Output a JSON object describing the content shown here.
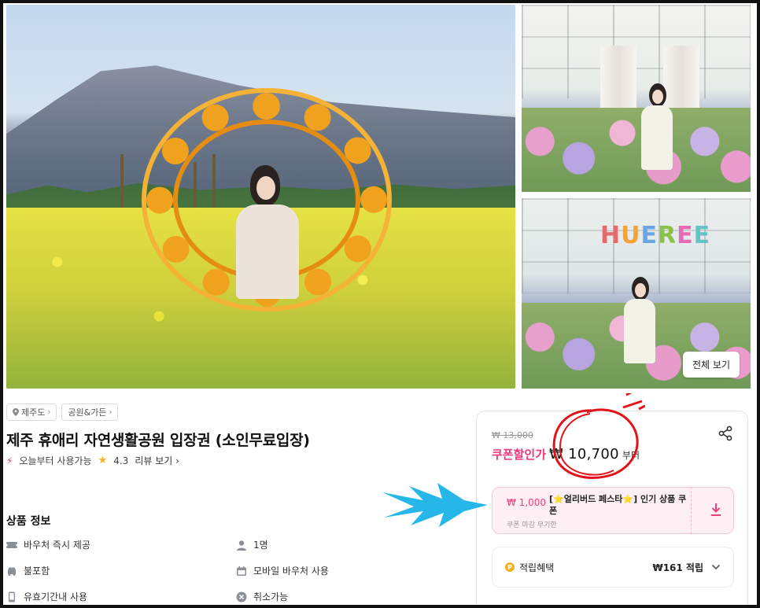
{
  "gallery": {
    "view_all_label": "전체 보기",
    "sign_letters": [
      "H",
      "U",
      "E",
      "R",
      "E",
      "E"
    ]
  },
  "breadcrumb": {
    "items": [
      {
        "label": "제주도",
        "icon": "location-pin-icon"
      },
      {
        "label": "공원&가든"
      }
    ]
  },
  "product": {
    "title": "제주 휴애리 자연생활공원 입장권 (소인무료입장)",
    "availability": "오늘부터 사용가능",
    "rating": "4.3",
    "review_link": "리뷰 보기"
  },
  "info": {
    "heading": "상품 정보",
    "items": [
      {
        "label": "바우처 즉시 제공",
        "icon": "ticket-icon"
      },
      {
        "label": "1명",
        "icon": "person-icon"
      },
      {
        "label": "불포함",
        "icon": "car-icon"
      },
      {
        "label": "모바일 바우처 사용",
        "icon": "calendar-icon"
      },
      {
        "label": "유효기간내 사용",
        "icon": "phone-icon"
      },
      {
        "label": "취소가능",
        "icon": "cancel-icon"
      }
    ]
  },
  "pricing": {
    "original": "₩ 13,000",
    "coupon_label": "쿠폰할인가",
    "price": "₩ 10,700",
    "price_suffix": "부터"
  },
  "coupon": {
    "amount": "₩ 1,000",
    "name": "[⭐얼리버드 페스타⭐] 인기 상품 쿠폰",
    "deadline": "쿠폰 마감 무기한"
  },
  "points": {
    "label": "적립혜택",
    "amount": "₩161 적립"
  },
  "colors": {
    "accent_pink": "#f0367a",
    "annotation_red": "#e1141b",
    "annotation_blue": "#27b6e8"
  }
}
